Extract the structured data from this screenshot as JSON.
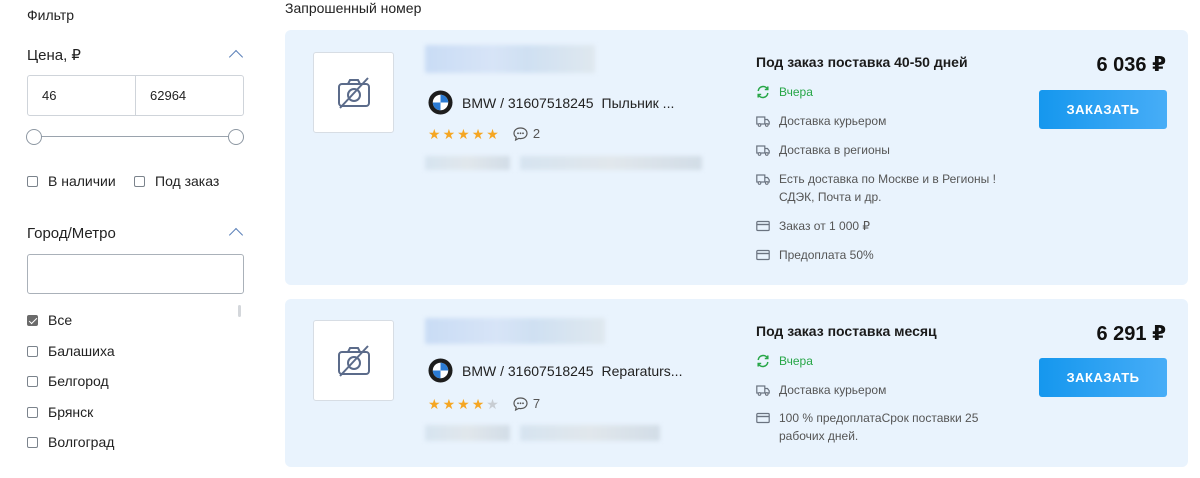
{
  "sidebar": {
    "title": "Фильтр",
    "price": {
      "label": "Цена, ₽",
      "min": "46",
      "max": "62964"
    },
    "availability": {
      "in_stock": "В наличии",
      "on_order": "Под заказ"
    },
    "city": {
      "label": "Город/Метро",
      "value": "",
      "options": [
        {
          "label": "Все",
          "checked": true
        },
        {
          "label": "Балашиха",
          "checked": false
        },
        {
          "label": "Белгород",
          "checked": false
        },
        {
          "label": "Брянск",
          "checked": false
        },
        {
          "label": "Волгоград",
          "checked": false
        }
      ]
    }
  },
  "main": {
    "title": "Запрошенный номер",
    "offers": [
      {
        "brand_part": "BMW / 31607518245",
        "name": "Пыльник ...",
        "rating": 5,
        "comments": "2",
        "delivery_title": "Под заказ поставка 40-50 дней",
        "seller_activity": "Вчера",
        "delivery_info": [
          {
            "icon": "truck-icon",
            "text": "Доставка курьером"
          },
          {
            "icon": "truck-icon",
            "text": "Доставка в регионы"
          },
          {
            "icon": "truck-icon",
            "text": "Есть доставка по Москве и в Регионы !",
            "text2": "СДЭК, Почта и др."
          },
          {
            "icon": "card-icon",
            "text": "Заказ от 1 000 ₽"
          },
          {
            "icon": "card-icon",
            "text": "Предоплата 50%"
          }
        ],
        "price": "6 036 ₽",
        "button": "ЗАКАЗАТЬ"
      },
      {
        "brand_part": "BMW / 31607518245",
        "name": "Reparaturs...",
        "rating": 4,
        "comments": "7",
        "delivery_title": "Под заказ поставка месяц",
        "seller_activity": "Вчера",
        "delivery_info": [
          {
            "icon": "truck-icon",
            "text": "Доставка курьером"
          },
          {
            "icon": "card-icon",
            "text": "100 % предоплатаСрок поставки 25",
            "text2": "рабочих дней."
          }
        ],
        "price": "6 291 ₽",
        "button": "ЗАКАЗАТЬ"
      }
    ]
  },
  "colors": {
    "card_bg": "#e9f3fd",
    "accent": "#1597ee",
    "star": "#f5a623",
    "green": "#27a647"
  }
}
